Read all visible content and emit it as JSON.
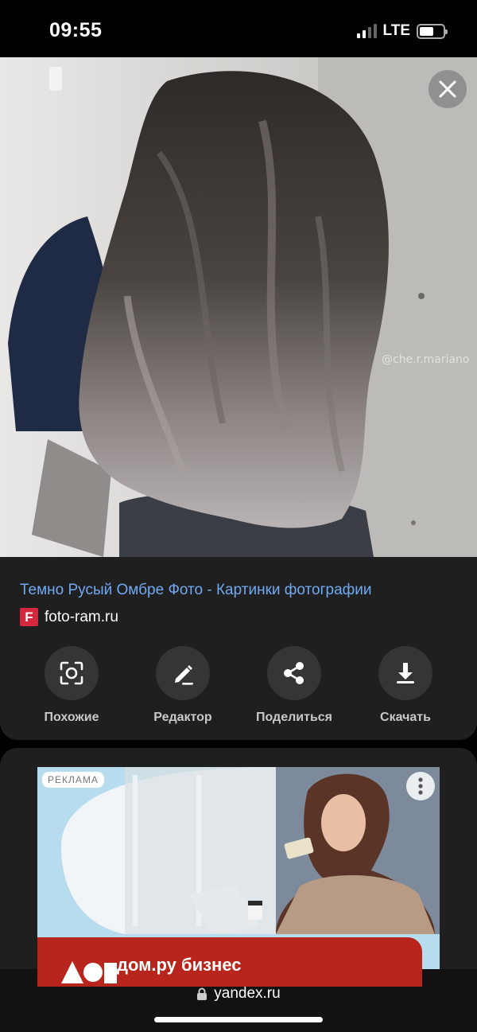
{
  "status_bar": {
    "time": "09:55",
    "network": "LTE"
  },
  "hero": {
    "watermark": "@che.r.mariano",
    "close_icon": "close-icon"
  },
  "info": {
    "title": "Темно Русый Омбре Фото - Картинки фотографии",
    "favicon_letter": "F",
    "domain": "foto-ram.ru",
    "title_color": "#6fa9f2"
  },
  "actions": [
    {
      "label": "Похожие",
      "icon": "camera-lens-icon"
    },
    {
      "label": "Редактор",
      "icon": "pencil-icon"
    },
    {
      "label": "Поделиться",
      "icon": "share-icon"
    },
    {
      "label": "Скачать",
      "icon": "download-icon"
    }
  ],
  "ad": {
    "badge": "РЕКЛАМА",
    "brand": "дом.ру бизнес",
    "banner_color": "#b8251d"
  },
  "bottom_bar": {
    "url": "yandex.ru"
  }
}
